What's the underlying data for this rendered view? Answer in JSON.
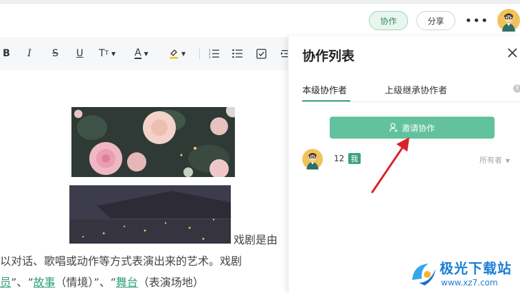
{
  "header": {
    "collab_label": "协作",
    "share_label": "分享",
    "more_label": "•••"
  },
  "toolbar": {
    "bold": "B",
    "italic": "I",
    "strike": "S",
    "underline": "U",
    "font_size": "T",
    "font_color": "A"
  },
  "document": {
    "line1": "戏剧是由",
    "line2": "以对话、歌唱或动作等方式表演出来的艺术。戏剧",
    "line3_a": "员",
    "line3_b": "”、“",
    "line3_link1": "故事",
    "line3_c": "（情境）”、“",
    "line3_link2": "舞台",
    "line3_d": "（表演场地）"
  },
  "panel": {
    "title": "协作列表",
    "tab_current": "本级协作者",
    "tab_inherited": "上级继承协作者",
    "info": "!",
    "invite_label": "邀请协作",
    "member": {
      "name": "12",
      "me_badge": "我",
      "role": "所有者"
    }
  },
  "watermark": {
    "title": "极光下载站",
    "url": "www.xz7.com"
  },
  "colors": {
    "accent": "#3aa37e",
    "invite_button": "#62c29e",
    "arrow": "#d9232a",
    "watermark": "#1a7fd6"
  }
}
